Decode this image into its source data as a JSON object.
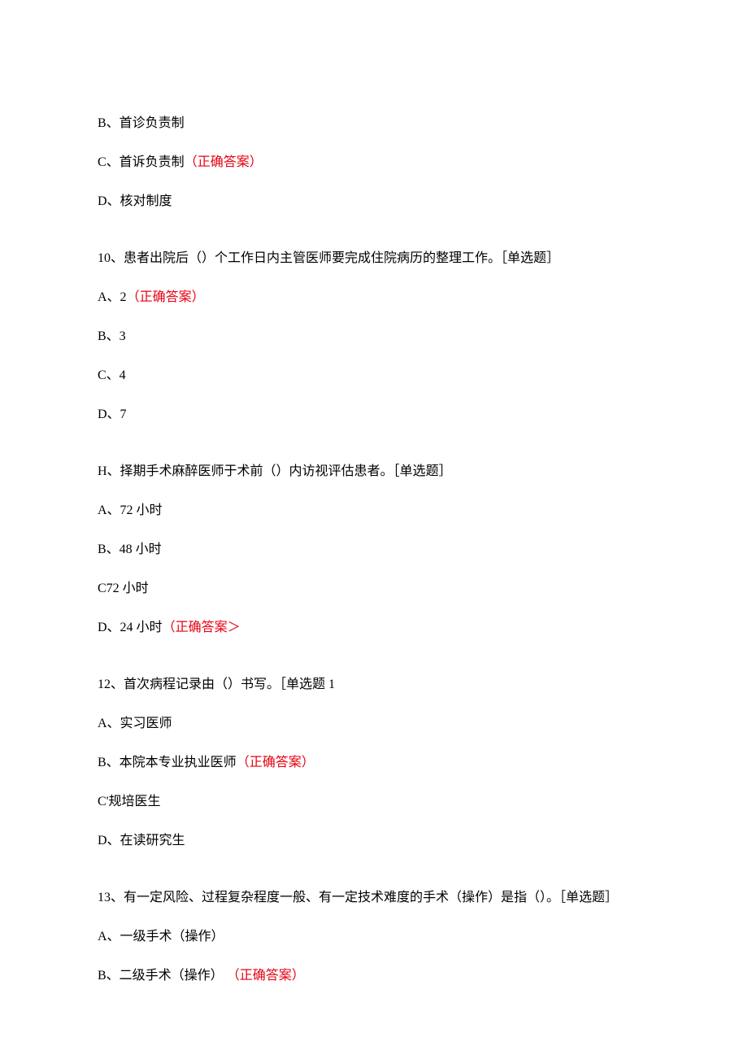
{
  "correct_label": "（正确答案）",
  "correct_label_alt": "（正确答案＞",
  "q9": {
    "options": {
      "b": "B、首诊负责制",
      "c_text": "C、首诉负责制",
      "d": "D、核对制度"
    }
  },
  "q10": {
    "stem": "10、患者出院后（）个工作日内主管医师要完成住院病历的整理工作。［单选题］",
    "options": {
      "a_text": "A、2",
      "b": "B、3",
      "c": "C、4",
      "d": "D、7"
    }
  },
  "q11": {
    "stem": "H、择期手术麻醉医师于术前（）内访视评估患者。［单选题］",
    "options": {
      "a": "A、72 小时",
      "b": "B、48 小时",
      "c": "C72 小时",
      "d_text": "D、24 小时"
    }
  },
  "q12": {
    "stem": "12、首次病程记录由（）书写。［单选题 1",
    "options": {
      "a": "A、实习医师",
      "b_text": "B、本院本专业执业医师",
      "c": "C'规培医生",
      "d": "D、在读研究生"
    }
  },
  "q13": {
    "stem": "13、有一定风险、过程复杂程度一般、有一定技术难度的手术（操作）是指（）。［单选题］",
    "options": {
      "a": "A、一级手术（操作）",
      "b_text": "B、二级手术（操作）"
    }
  }
}
